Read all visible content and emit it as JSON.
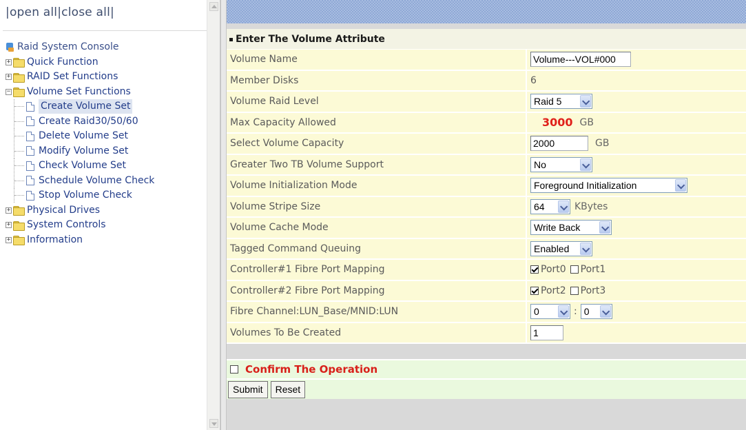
{
  "tree": {
    "open_all": "open all",
    "close_all": "close all",
    "root": "Raid System Console",
    "items": [
      {
        "label": "Quick Function",
        "expanded": false
      },
      {
        "label": "RAID Set Functions",
        "expanded": false
      },
      {
        "label": "Volume Set Functions",
        "expanded": true,
        "children": [
          "Create Volume Set",
          "Create Raid30/50/60",
          "Delete Volume Set",
          "Modify Volume Set",
          "Check Volume Set",
          "Schedule Volume Check",
          "Stop Volume Check"
        ]
      },
      {
        "label": "Physical Drives",
        "expanded": false
      },
      {
        "label": "System Controls",
        "expanded": false
      },
      {
        "label": "Information",
        "expanded": false
      }
    ],
    "selected": "Create Volume Set"
  },
  "form": {
    "title": "Enter The Volume Attribute",
    "rows": {
      "volume_name": {
        "label": "Volume Name",
        "value": "Volume---VOL#000"
      },
      "member_disks": {
        "label": "Member Disks",
        "value": "6"
      },
      "raid_level": {
        "label": "Volume Raid Level",
        "value": "Raid 5"
      },
      "max_capacity": {
        "label": "Max Capacity Allowed",
        "value": "3000",
        "unit": "GB"
      },
      "select_capacity": {
        "label": "Select Volume Capacity",
        "value": "2000",
        "unit": "GB"
      },
      "two_tb": {
        "label": "Greater Two TB Volume Support",
        "value": "No"
      },
      "init_mode": {
        "label": "Volume Initialization Mode",
        "value": "Foreground Initialization"
      },
      "stripe_size": {
        "label": "Volume Stripe Size",
        "value": "64",
        "unit": "KBytes"
      },
      "cache_mode": {
        "label": "Volume Cache Mode",
        "value": "Write Back"
      },
      "tcq": {
        "label": "Tagged Command Queuing",
        "value": "Enabled"
      },
      "ctrl1": {
        "label": "Controller#1 Fibre Port Mapping",
        "port_a": "Port0",
        "port_a_checked": true,
        "port_b": "Port1",
        "port_b_checked": false
      },
      "ctrl2": {
        "label": "Controller#2 Fibre Port Mapping",
        "port_a": "Port2",
        "port_a_checked": true,
        "port_b": "Port3",
        "port_b_checked": false
      },
      "lun": {
        "label": "Fibre Channel:LUN_Base/MNID:LUN",
        "base": "0",
        "sep": ":",
        "lun": "0"
      },
      "count": {
        "label": "Volumes To Be Created",
        "value": "1"
      }
    },
    "confirm_label": "Confirm The Operation",
    "submit_label": "Submit",
    "reset_label": "Reset"
  },
  "colors": {
    "row_bg": "#fcfad6",
    "confirm_bg": "#eaf9de",
    "accent_red": "#e0201a",
    "tree_text": "#233d8a"
  }
}
